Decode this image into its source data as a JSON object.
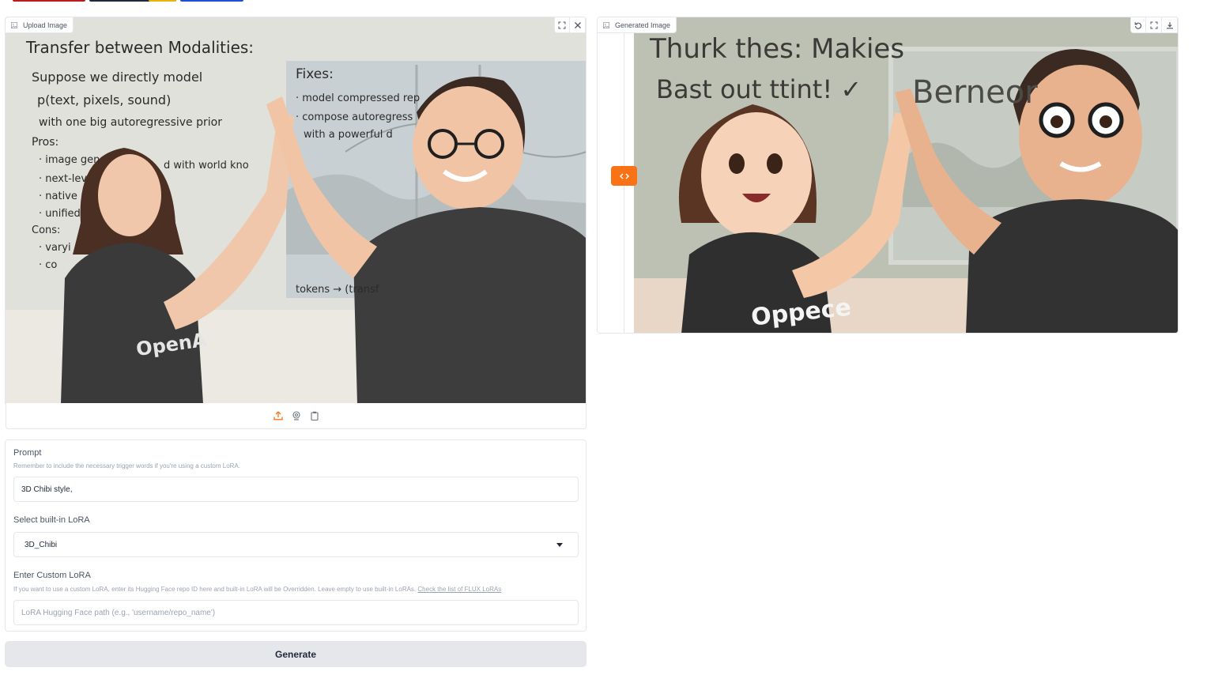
{
  "colors": {
    "accent": "#f97316",
    "border": "#e5e7eb",
    "button_bg": "#e5e7eb"
  },
  "upload_panel": {
    "label": "Upload Image",
    "tools": [
      "fullscreen-icon",
      "close-icon"
    ],
    "source_buttons": [
      "upload-icon",
      "webcam-icon",
      "clipboard-icon"
    ],
    "whiteboard_lines": [
      "Transfer between Modalities:",
      "Suppose we directly model",
      "p(text, pixels, sound)",
      "with one big autoregressive prior",
      "Pros:",
      "· image gen",
      "d with world kno",
      "· next-lev",
      "· native",
      "· unified",
      "Cons:",
      "· varyi",
      "· co",
      "Fixes:",
      "· model compressed rep",
      "· compose autoregress",
      "with a powerful d",
      "tokens → (transf"
    ],
    "shirt_text": "OpenA"
  },
  "generated_panel": {
    "label": "Generated Image",
    "tools": [
      "undo-icon",
      "fullscreen-icon",
      "download-icon"
    ],
    "whiteboard_lines": [
      "Thurk thes: Makies",
      "Bast out ttint! ✓"
    ],
    "window_text": "Berneor",
    "shirt_text": "Oppece"
  },
  "prompt": {
    "label": "Prompt",
    "info": "Remember to include the necessary trigger words if you're using a custom LoRA.",
    "value": "3D Chibi style,"
  },
  "lora_select": {
    "label": "Select built-in LoRA",
    "value": "3D_Chibi"
  },
  "custom_lora": {
    "label": "Enter Custom LoRA",
    "info": "If you want to use a custom LoRA, enter its Hugging Face repo ID here and built-in LoRA will be Overridden. Leave empty to use built-in LoRAs.",
    "info_link": "Check the list of FLUX LoRAs",
    "placeholder": "LoRA Hugging Face path (e.g., 'username/repo_name')"
  },
  "generate_button": "Generate"
}
